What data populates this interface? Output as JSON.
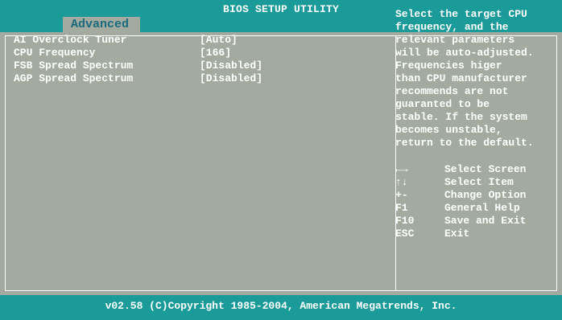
{
  "header": {
    "title": "BIOS SETUP UTILITY",
    "active_tab": "Advanced"
  },
  "settings": [
    {
      "label": "AI Overclock Tuner",
      "value": "[Auto]"
    },
    {
      "label": "CPU Frequency",
      "value": "[166]"
    },
    {
      "label": "FSB Spread Spectrum",
      "value": "[Disabled]"
    },
    {
      "label": "AGP Spread Spectrum",
      "value": "[Disabled]"
    }
  ],
  "help": {
    "text": "Select the target CPU\nfrequency, and the\nrelevant parameters\nwill be auto-adjusted.\nFrequencies higer\nthan CPU manufacturer\nrecommends are not\nguaranted to be\nstable. If the system\nbecomes unstable,\nreturn to the default."
  },
  "keys": [
    {
      "key": "←→",
      "action": "Select Screen"
    },
    {
      "key": "↑↓",
      "action": "Select Item"
    },
    {
      "key": "+-",
      "action": "Change Option"
    },
    {
      "key": "F1",
      "action": "General Help"
    },
    {
      "key": "F10",
      "action": "Save and Exit"
    },
    {
      "key": "ESC",
      "action": "Exit"
    }
  ],
  "footer": {
    "copyright": "v02.58 (C)Copyright 1985-2004, American Megatrends, Inc."
  },
  "colors": {
    "header_bar": "#1a9a98",
    "panel_background": "#a3aba0",
    "tab_text": "#1a6a7e",
    "text": "#ffffff"
  }
}
